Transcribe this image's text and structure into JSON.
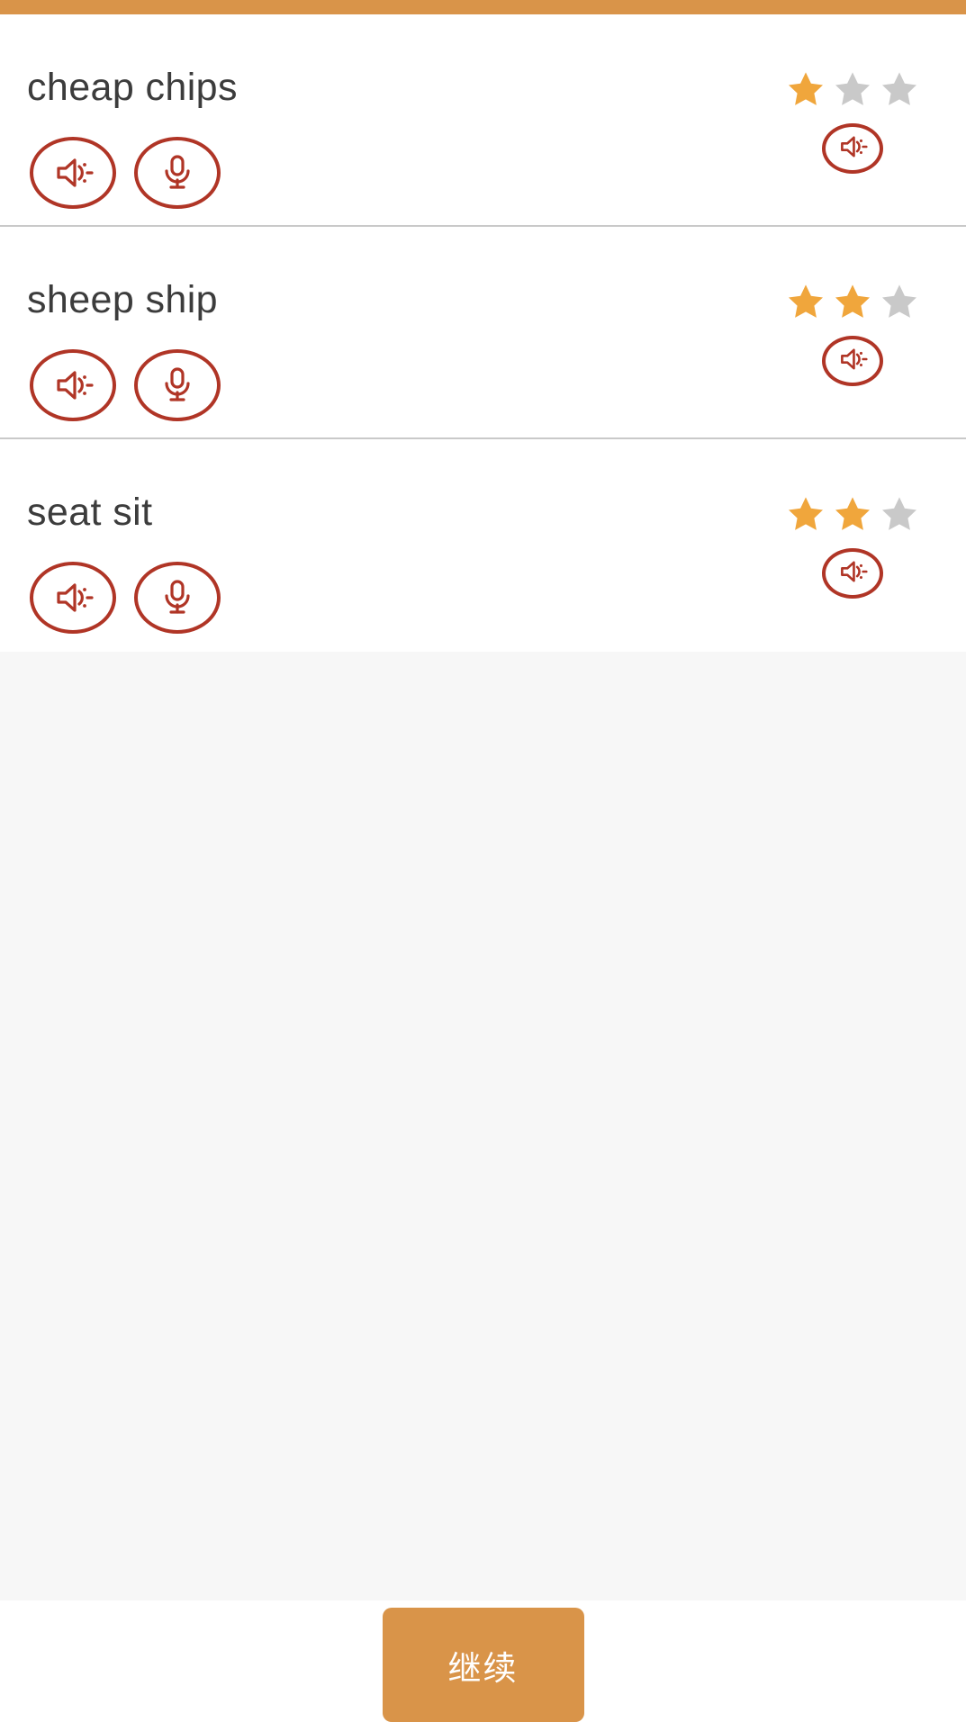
{
  "theme": {
    "accent_orange": "#d99449",
    "star_filled": "#f0a63c",
    "star_empty": "#c9c9c9",
    "icon_red": "#b03526",
    "text_dark": "#3c3c3c",
    "page_bg": "#f7f7f7",
    "card_bg": "#ffffff"
  },
  "top_bar": {
    "name": "progress-bar",
    "color": "#d99449"
  },
  "word_list": {
    "rows": [
      {
        "word": "cheap chips",
        "stars_filled": 1,
        "stars_total": 3,
        "play_icon": "speaker-icon",
        "record_icon": "microphone-icon",
        "result_icon": "speaker-icon"
      },
      {
        "word": "sheep ship",
        "stars_filled": 2,
        "stars_total": 3,
        "play_icon": "speaker-icon",
        "record_icon": "microphone-icon",
        "result_icon": "speaker-icon"
      },
      {
        "word": "seat sit",
        "stars_filled": 2,
        "stars_total": 3,
        "play_icon": "speaker-icon",
        "record_icon": "microphone-icon",
        "result_icon": "speaker-icon"
      }
    ]
  },
  "footer": {
    "continue_label": "继续"
  }
}
